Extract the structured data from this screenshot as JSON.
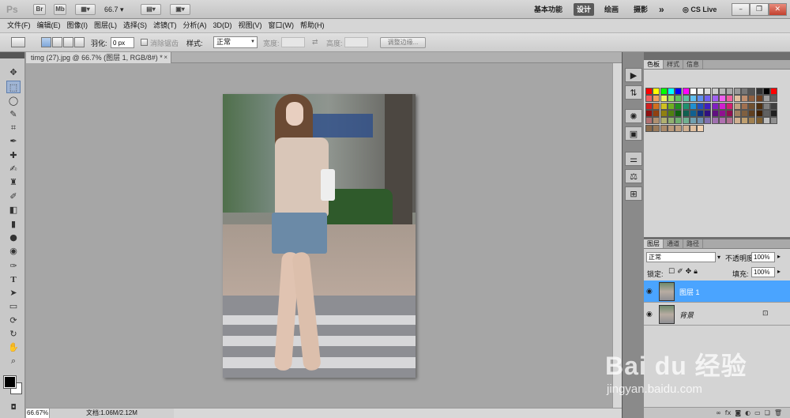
{
  "appbar": {
    "logo": "Ps",
    "br_button": "Br",
    "mb_button": "Mb",
    "zoom_value": "66.7",
    "workspaces": [
      "基本功能",
      "设计",
      "绘画",
      "摄影"
    ],
    "active_workspace": "设计",
    "more": "»",
    "cs_live": "CS Live"
  },
  "menu": [
    "文件(F)",
    "编辑(E)",
    "图像(I)",
    "图层(L)",
    "选择(S)",
    "滤镜(T)",
    "分析(A)",
    "3D(D)",
    "视图(V)",
    "窗口(W)",
    "帮助(H)"
  ],
  "options": {
    "feather_label": "羽化:",
    "feather_value": "0 px",
    "antialias_label": "消除锯齿",
    "style_label": "样式:",
    "style_value": "正常",
    "width_label": "宽度:",
    "height_label": "高度:",
    "refine_edge": "调整边缘..."
  },
  "document": {
    "tab_title": "timg (27).jpg @ 66.7% (图层 1, RGB/8#) *",
    "close_symbol": "×",
    "zoom": "66.67%",
    "doc_info": "文档:1.06M/2.12M"
  },
  "panels": {
    "color_tabs": [
      "色板",
      "样式",
      "信息"
    ],
    "layer_tabs": [
      "图层",
      "通道",
      "路径"
    ],
    "blend_mode": "正常",
    "opacity_label": "不透明度:",
    "opacity_value": "100%",
    "lock_label": "锁定:",
    "fill_label": "填充:",
    "fill_value": "100%",
    "layers": [
      {
        "name": "图层 1",
        "selected": true
      },
      {
        "name": "背景",
        "selected": false,
        "locked": true
      }
    ]
  },
  "watermark": {
    "line1": "Bai du 经验",
    "line2": "jingyan.baidu.com"
  },
  "colors": {
    "selected_layer": "#4aa4ff",
    "active_workspace_bg": "#5a5a5a"
  }
}
